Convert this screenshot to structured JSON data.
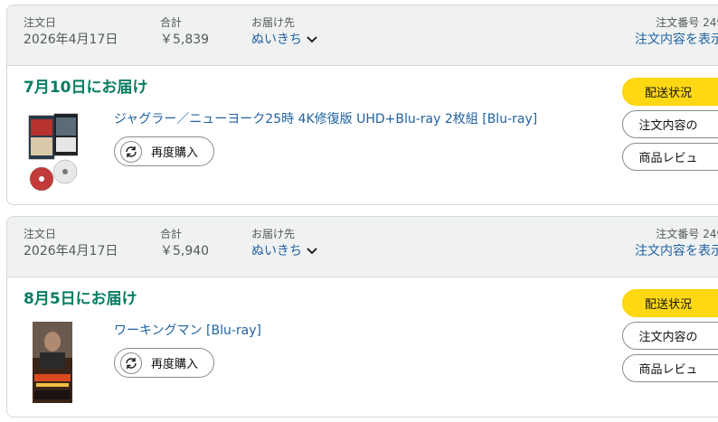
{
  "orders": [
    {
      "order_date_label": "注文日",
      "order_date": "2026年4月17日",
      "total_label": "合計",
      "total": "￥5,839",
      "ship_to_label": "お届け先",
      "ship_to": "ぬいきち",
      "order_number_label": "注文番号 249",
      "order_details_link": "注文内容を表示",
      "delivery_status": "7月10日にお届け",
      "product_title": "ジャグラー／ニューヨーク25時 4K修復版 UHD+Blu-ray 2枚組 [Blu-ray]",
      "buy_again_label": "再度購入",
      "track_package_label": "配送状況",
      "contact_button_label": "注文内容の",
      "review_button_label": "商品レビュ"
    },
    {
      "order_date_label": "注文日",
      "order_date": "2026年4月17日",
      "total_label": "合計",
      "total": "￥5,940",
      "ship_to_label": "お届け先",
      "ship_to": "ぬいきち",
      "order_number_label": "注文番号 249",
      "order_details_link": "注文内容を表示",
      "delivery_status": "8月5日にお届け",
      "product_title": "ワーキングマン [Blu-ray]",
      "buy_again_label": "再度購入",
      "track_package_label": "配送状況",
      "contact_button_label": "注文内容の",
      "review_button_label": "商品レビュ"
    }
  ],
  "icons": {
    "ship_to_dropdown": "chevron-down-icon",
    "buy_again": "reorder-cycle-icon",
    "thumb_0": "bluray-box-set-image",
    "thumb_1": "movie-poster-image"
  },
  "colors": {
    "header_bg": "#f0f2f2",
    "link": "#2162a1",
    "delivery_green": "#067d62",
    "primary_button": "#ffd814",
    "border": "#d5d9d9"
  }
}
